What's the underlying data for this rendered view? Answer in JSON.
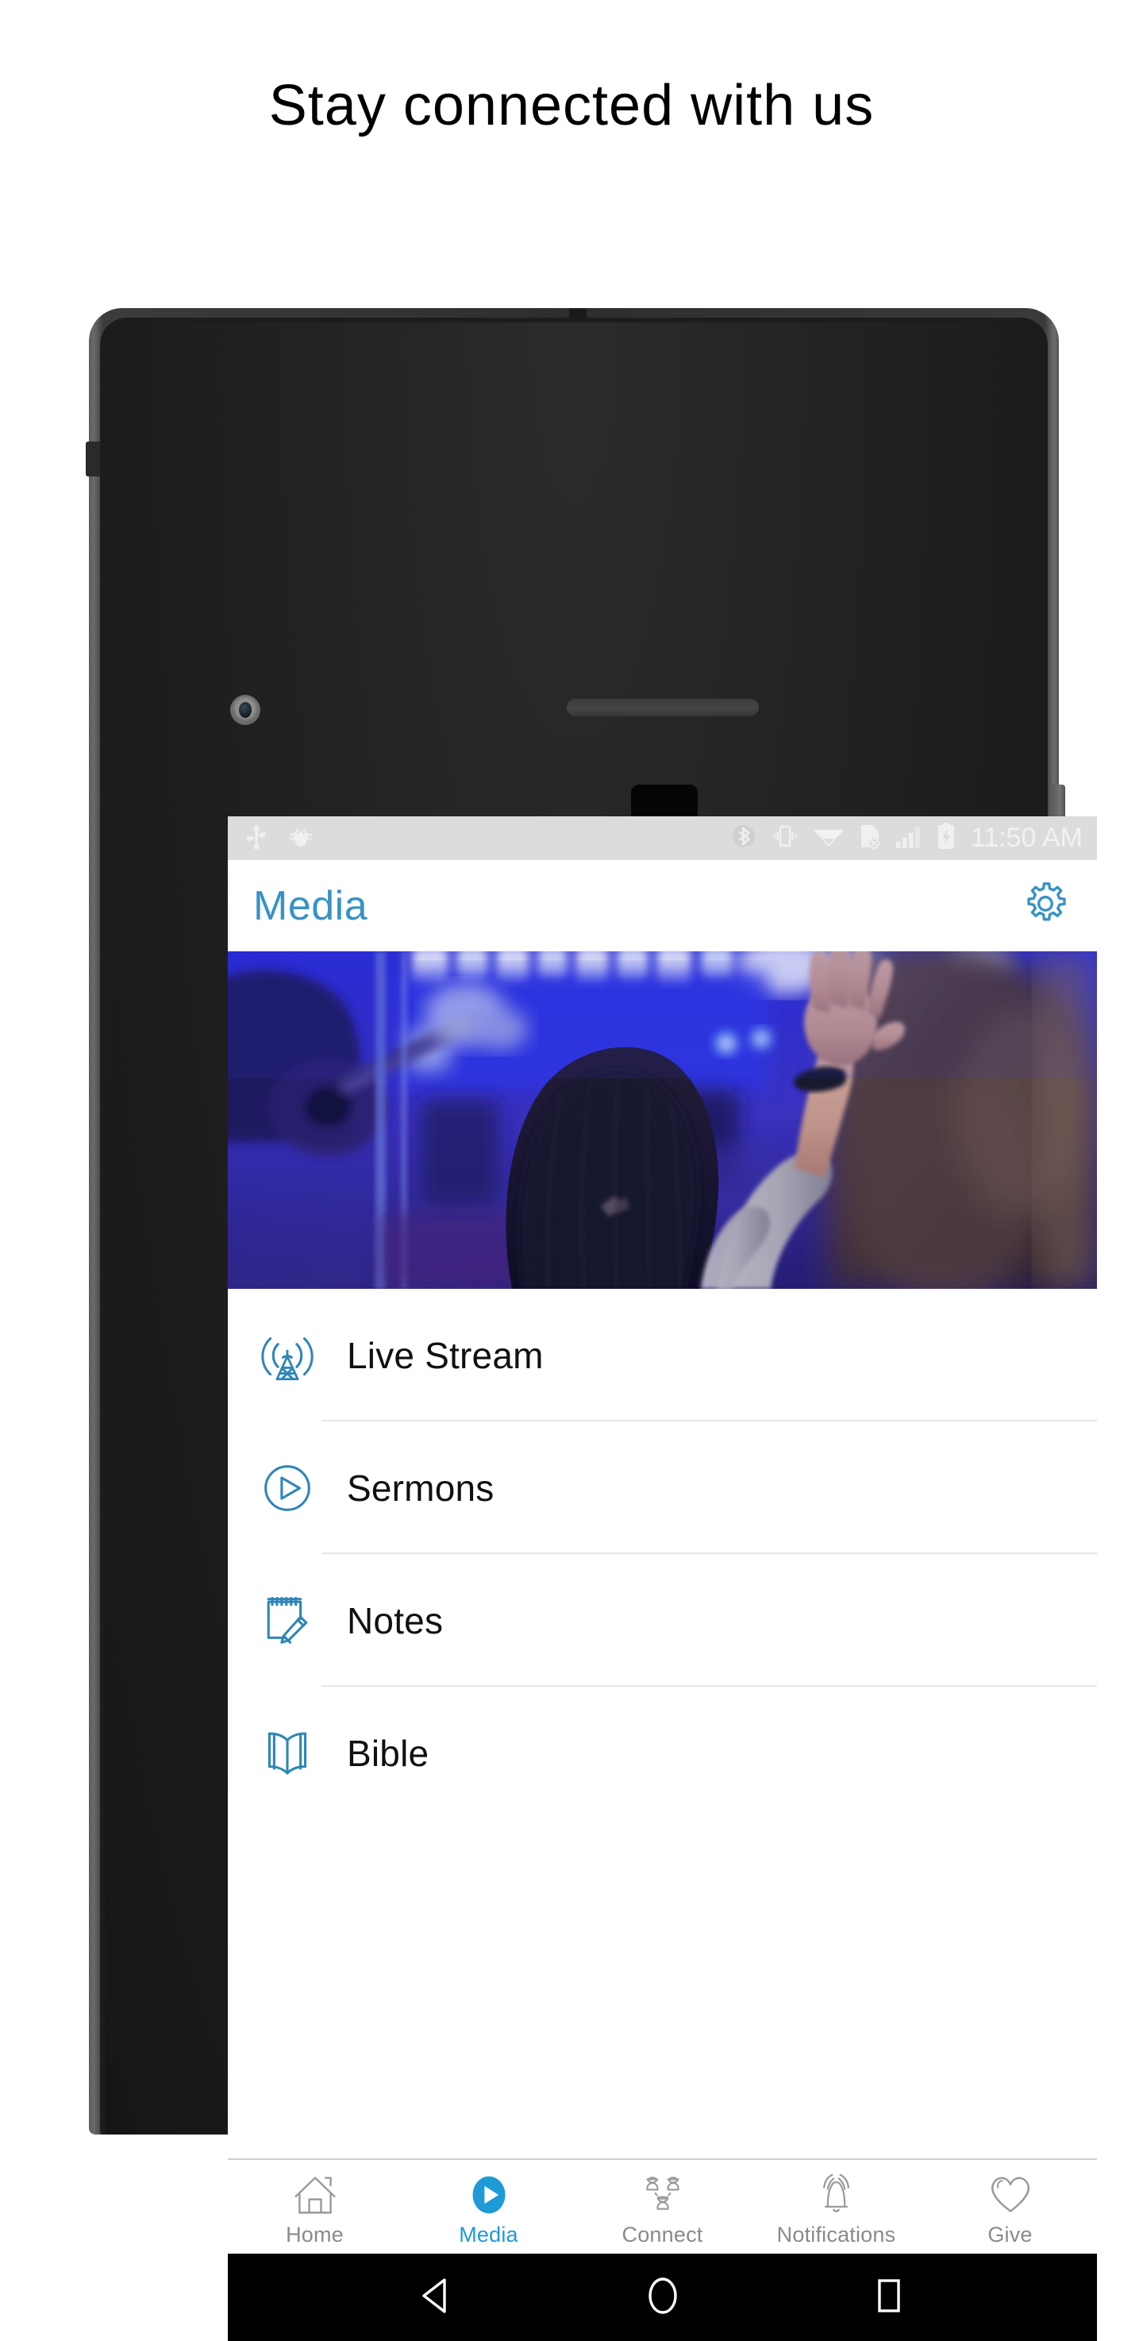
{
  "heading": "Stay connected with us",
  "statusbar": {
    "left_icons": [
      "usb-icon",
      "android-debug-bug-icon"
    ],
    "right_icons": [
      "bluetooth-icon",
      "vibrate-icon",
      "wifi-icon",
      "no-sim-icon",
      "cellular-signal-icon",
      "battery-charging-icon"
    ],
    "time": "11:50 AM"
  },
  "appbar": {
    "title": "Media",
    "settings_icon": "gear-icon"
  },
  "hero": {
    "alt": "worship-service-photo"
  },
  "menu": {
    "items": [
      {
        "label": "Live Stream",
        "icon": "broadcast-tower-icon"
      },
      {
        "label": "Sermons",
        "icon": "play-circle-outline-icon"
      },
      {
        "label": "Notes",
        "icon": "notepad-pencil-icon"
      },
      {
        "label": "Bible",
        "icon": "open-book-icon"
      }
    ]
  },
  "tabbar": {
    "items": [
      {
        "label": "Home",
        "icon": "house-icon",
        "active": false
      },
      {
        "label": "Media",
        "icon": "play-circle-filled-icon",
        "active": true
      },
      {
        "label": "Connect",
        "icon": "people-group-icon",
        "active": false
      },
      {
        "label": "Notifications",
        "icon": "bell-ringing-icon",
        "active": false
      },
      {
        "label": "Give",
        "icon": "heart-icon",
        "active": false
      }
    ]
  },
  "navbar": {
    "items": [
      {
        "icon": "back-triangle-icon"
      },
      {
        "icon": "home-circle-icon"
      },
      {
        "icon": "recents-square-icon"
      }
    ]
  },
  "colors": {
    "accent_blue": "#3892c4",
    "tab_active_blue": "#1e9ad6",
    "statusbar_gray": "#dcdcdc",
    "label_gray": "#8a8a8a",
    "divider": "#e6e6e6"
  }
}
